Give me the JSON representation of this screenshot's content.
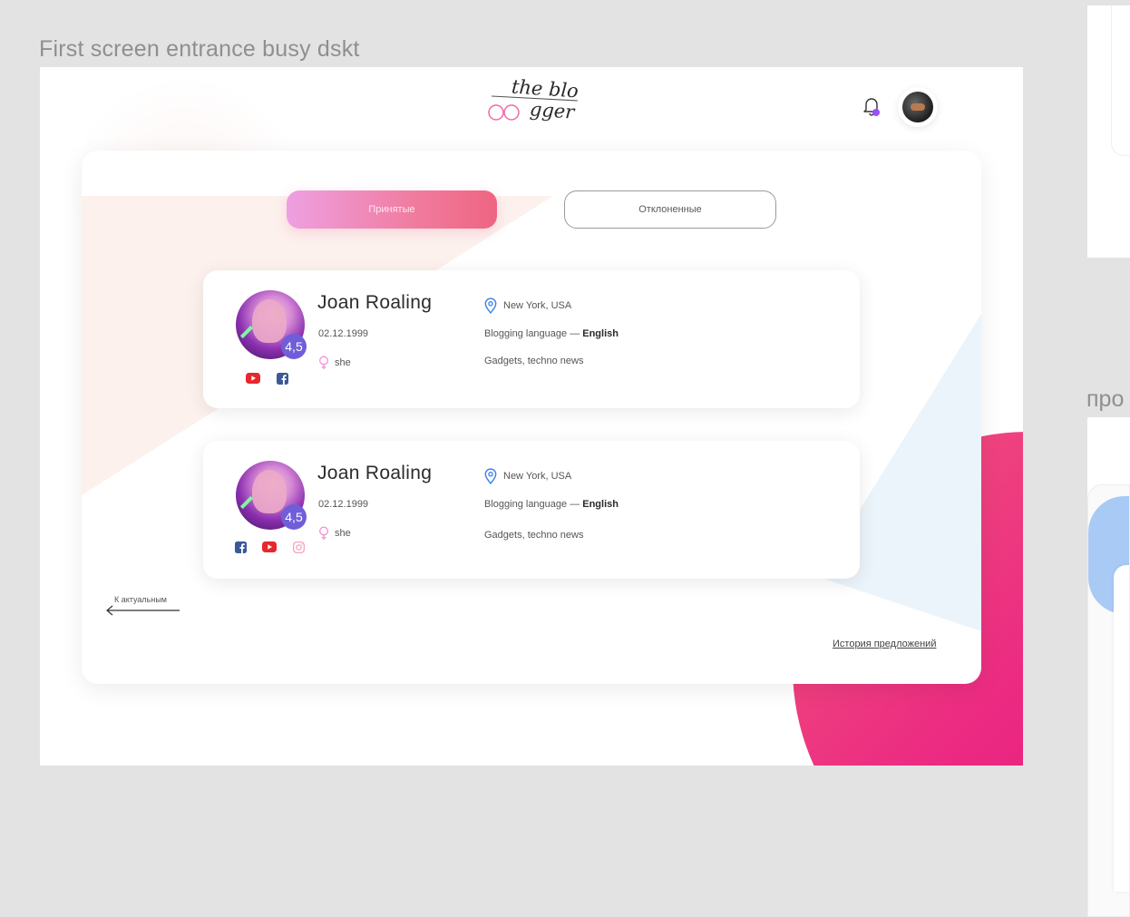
{
  "canvas": {
    "frame_title": "First screen entrance busy dskt",
    "right_frame_label": "про"
  },
  "header": {
    "logo_line1": "the blo",
    "logo_line2": "gger",
    "notification_dot_color": "#9b4dff"
  },
  "tabs": {
    "accepted_label": "Принятые",
    "rejected_label": "Отклоненные"
  },
  "bloggers": [
    {
      "name": "Joan Roaling",
      "birth_date": "02.12.1999",
      "pronoun": "she",
      "rating": "4,5",
      "location": "New York, USA",
      "language_prefix": "Blogging language — ",
      "language": "English",
      "topics": "Gadgets, techno news",
      "socials": [
        "youtube-icon",
        "facebook-icon"
      ]
    },
    {
      "name": "Joan Roaling",
      "birth_date": "02.12.1999",
      "pronoun": "she",
      "rating": "4,5",
      "location": "New York, USA",
      "language_prefix": "Blogging language — ",
      "language": "English",
      "topics": "Gadgets, techno news",
      "socials": [
        "facebook-icon",
        "youtube-icon",
        "instagram-icon"
      ]
    }
  ],
  "footer": {
    "back_label": "К актуальным",
    "history_link": "История предложений"
  },
  "colors": {
    "accent_pink": "#ef6581",
    "accent_violet": "#6f5ed8",
    "blob_pink": "#ec2a82",
    "youtube": "#e6272e",
    "facebook": "#3b5998"
  }
}
